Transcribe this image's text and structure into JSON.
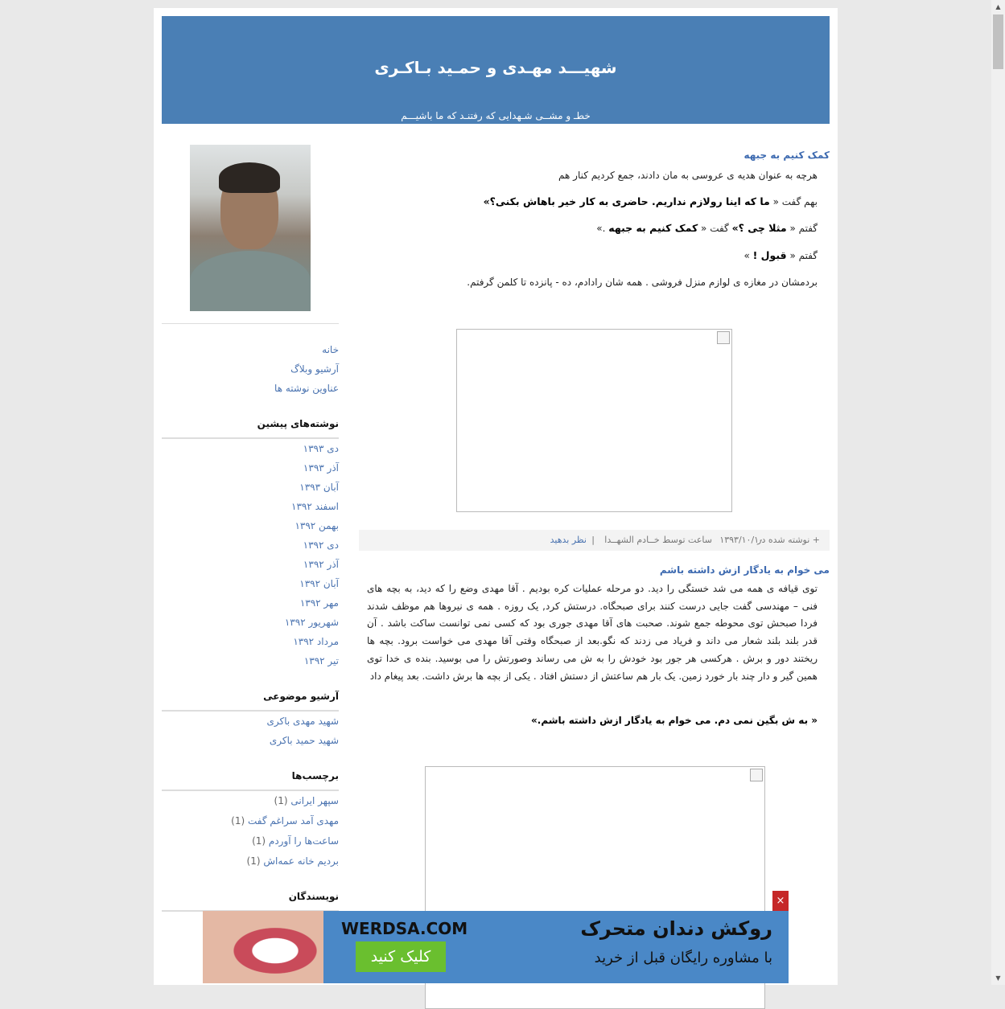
{
  "header": {
    "title": "شهیـــد مهـدی و حمـید بـاکـری",
    "description": "خطـ و مشــی شـهدایی که رفتنـد که ما باشیـــم"
  },
  "sidebar": {
    "nav": [
      "خانه",
      "آرشیو وبلاگ",
      "عناوین نوشته ها"
    ],
    "previous_heading": "نوشته‌های پیشین",
    "previous": [
      "دی ۱۳۹۳",
      "آذر ۱۳۹۳",
      "آبان ۱۳۹۳",
      "اسفند ۱۳۹۲",
      "بهمن ۱۳۹۲",
      "دی ۱۳۹۲",
      "آذر ۱۳۹۲",
      "آبان ۱۳۹۲",
      "مهر ۱۳۹۲",
      "شهریور ۱۳۹۲",
      "مرداد ۱۳۹۲",
      "تیر ۱۳۹۲"
    ],
    "topics_heading": "آرشیو موضوعی",
    "topics": [
      "شهید مهدی باکری",
      "شهید حمید باکری"
    ],
    "tags_heading": "برچسب‌ها",
    "tags": [
      {
        "label": "سپهر ایرانی",
        "count": "(1)"
      },
      {
        "label": "مهدی آمد سراغم گفت",
        "count": "(1)"
      },
      {
        "label": "ساعت‌ها را آوردم",
        "count": "(1)"
      },
      {
        "label": "بردیم خانه عمه‌اش",
        "count": "(1)"
      }
    ],
    "authors_heading": "نویسندگان"
  },
  "posts": [
    {
      "title": "کمک کنیم به جبهه",
      "line1": "هرچه به عنوان هدیه ی عروسی به مان دادند، جمع کردیم کنار هم",
      "line2_pre": "بهم گفت « ",
      "line2_bold": "ما که اینا رولازم نداریم. حاضری به کار خیر باهاش بکنی؟»",
      "line3_pre": "گفتم « ",
      "line3_bold1": "مثلا چی ؟»",
      "line3_mid": " گفت « ",
      "line3_bold2": "کمک کنیم به جبهه",
      "line3_post": " .»",
      "line4_pre": "گفتم « ",
      "line4_bold": "قبول !",
      "line4_post": " »",
      "line5": "بردمشان در مغازه ی لوازم منزل فروشی . همه شان رادادم، ده - پانزده تا کلمن گرفتم.",
      "footer_prefix": "+ نوشته شده در",
      "footer_date": "۱۳۹۳/۱۰/۱۰",
      "footer_by": "ساعت توسط خــادم الشهــدا",
      "footer_sep": "|",
      "footer_comment": "نظر بدهید"
    },
    {
      "title": "می خوام به یادگار ازش داشته باشم",
      "paragraph": "توی قیافه ی همه می شد خستگی را دید. دو مرحله عملیات کره بودیم . آقا مهدی وضع را که دید، به بچه های فنی – مهندسی گفت جایی درست کنند برای صبحگاه. درستش کرد, یک روزه . همه ی نیروها هم موظف شدند فردا صبحش توی محوطه جمع شوند. صحبت های آقا مهدی جوری بود که کسی نمی توانست ساکت باشد . آن قدر بلند بلند شعار می داند و فریاد می زدند که نگو.بعد از صبحگاه وقتی آقا مهدی می خواست برود. بچه ها ریختند دور و برش . هرکسی هر جور بود خودش را به ش می رساند وصورتش را می بوسید. بنده ی خدا توی همین گیر و دار چند بار خورد زمین. یک بار هم ساعتش از دستش افتاد . یکی از بچه ها برش داشت. بعد پیغام داد",
      "quote": "« به ش بگین نمی دم. می خوام به یادگار ازش داشته باشم.»"
    }
  ],
  "ad": {
    "brand": "WERDSA.COM",
    "cta": "کلیک کنید",
    "headline": "روکش دندان متحرک",
    "subline": "با مشاوره رایگان قبل از خرید",
    "close": "×"
  },
  "colors": {
    "header_bg": "#4a7fb5",
    "link": "#4a73b0",
    "post_title": "#3d6ab0",
    "ad_bg": "#4a88c7",
    "ad_cta": "#6abf2f",
    "ad_close": "#c62828"
  }
}
